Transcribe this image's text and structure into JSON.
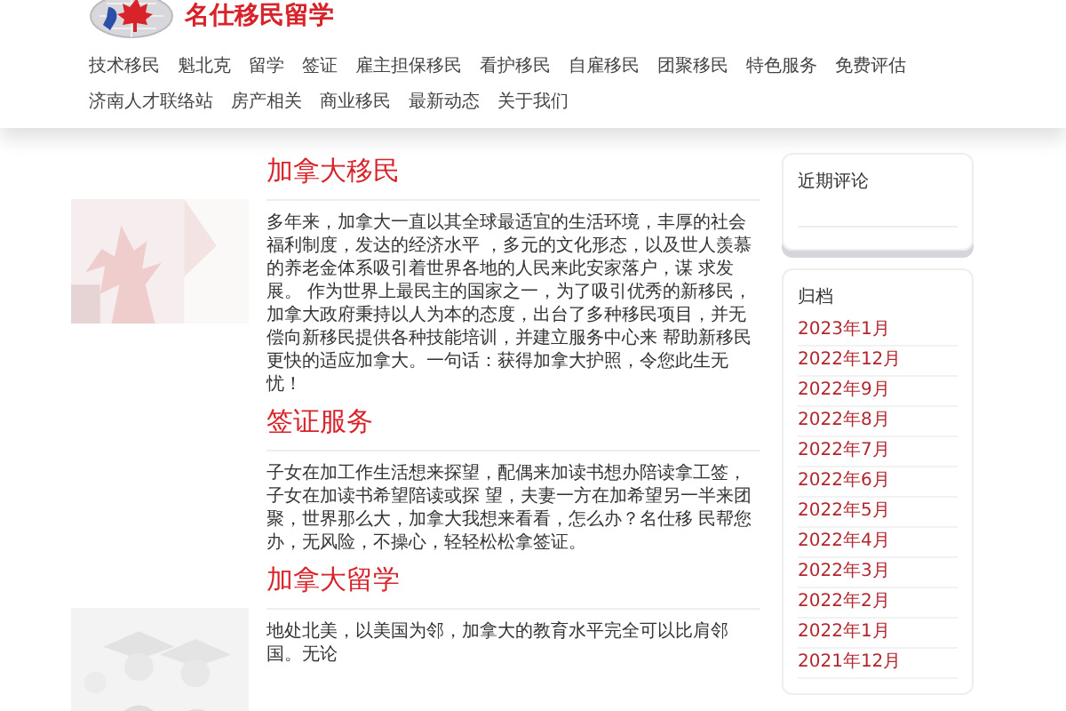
{
  "site": {
    "title": "名仕移民留学"
  },
  "nav": [
    {
      "label": "技术移民"
    },
    {
      "label": "魁北克"
    },
    {
      "label": "留学"
    },
    {
      "label": "签证"
    },
    {
      "label": "雇主担保移民"
    },
    {
      "label": "看护移民"
    },
    {
      "label": "自雇移民"
    },
    {
      "label": "团聚移民"
    },
    {
      "label": "特色服务"
    },
    {
      "label": "免费评估"
    },
    {
      "label": "济南人才联络站"
    },
    {
      "label": "房产相关"
    },
    {
      "label": "商业移民"
    },
    {
      "label": "最新动态"
    },
    {
      "label": "关于我们"
    }
  ],
  "sections": [
    {
      "title": "加拿大移民",
      "body": "多年来，加拿大一直以其全球最适宜的生活环境，丰厚的社会福利制度，发达的经济水平 ，多元的文化形态，以及世人羡慕的养老金体系吸引着世界各地的人民来此安家落户，谋 求发展。 作为世界上最民主的国家之一，为了吸引优秀的新移民，加拿大政府秉持以人为本的态度，出台了多种移民项目，并无偿向新移民提供各种技能培训，并建立服务中心来 帮助新移民更快的适应加拿大。一句话：获得加拿大护照，令您此生无忧！"
    },
    {
      "title": "签证服务",
      "body": "子女在加工作生活想来探望，配偶来加读书想办陪读拿工签，子女在加读书希望陪读或探 望，夫妻一方在加希望另一半来团聚，世界那么大，加拿大我想来看看，怎么办？名仕移 民帮您办，无风险，不操心，轻轻松松拿签证。"
    },
    {
      "title": "加拿大留学",
      "body": "地处北美，以美国为邻，加拿大的教育水平完全可以比肩邻国。无论"
    }
  ],
  "sidebar": {
    "recent_comments": {
      "title": "近期评论"
    },
    "archives": {
      "title": "归档",
      "items": [
        "2023年1月",
        "2022年12月",
        "2022年9月",
        "2022年8月",
        "2022年7月",
        "2022年6月",
        "2022年5月",
        "2022年4月",
        "2022年3月",
        "2022年2月",
        "2022年1月",
        "2021年12月"
      ]
    }
  }
}
